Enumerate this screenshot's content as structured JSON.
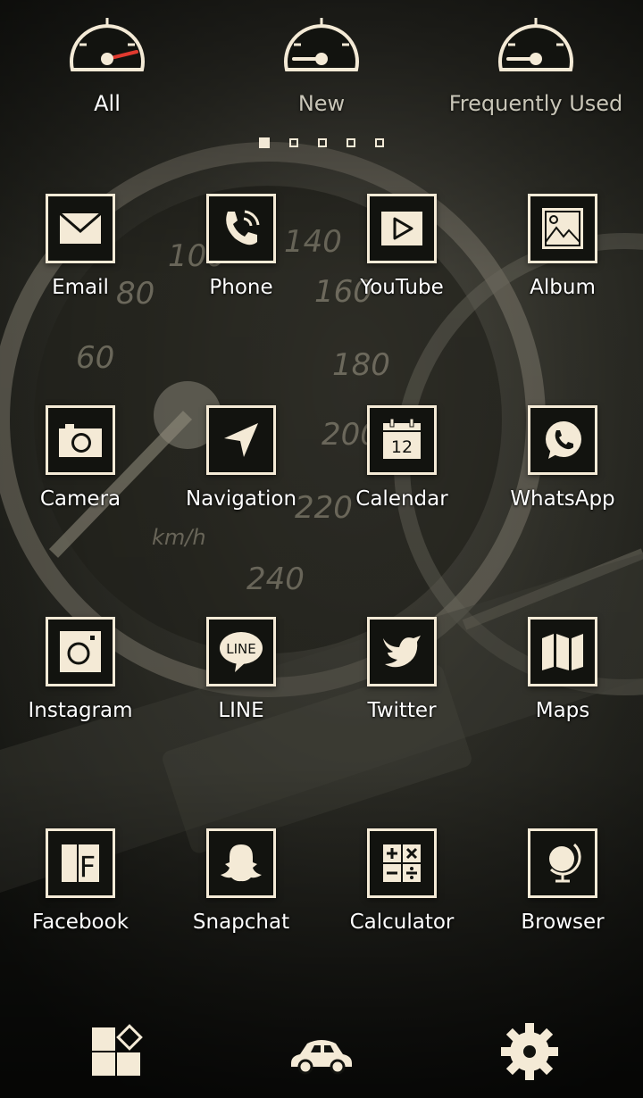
{
  "colors": {
    "accent": "#f4ead6",
    "tile_background": "#12130f",
    "needle": "#e03a2f",
    "label_active": "#ffffff",
    "label_inactive": "#c9c6b8"
  },
  "tabs": [
    {
      "label": "All",
      "icon": "speedometer-icon",
      "active": true
    },
    {
      "label": "New",
      "icon": "speedometer-icon",
      "active": false
    },
    {
      "label": "Frequently Used",
      "icon": "speedometer-icon",
      "active": false
    }
  ],
  "pager": {
    "pages": 5,
    "current": 1
  },
  "apps": [
    {
      "label": "Email",
      "icon": "envelope-icon"
    },
    {
      "label": "Phone",
      "icon": "phone-icon"
    },
    {
      "label": "YouTube",
      "icon": "play-icon"
    },
    {
      "label": "Album",
      "icon": "picture-icon"
    },
    {
      "label": "Camera",
      "icon": "camera-icon"
    },
    {
      "label": "Navigation",
      "icon": "arrow-icon"
    },
    {
      "label": "Calendar",
      "icon": "calendar-icon",
      "icon_text": "12"
    },
    {
      "label": "WhatsApp",
      "icon": "whatsapp-icon"
    },
    {
      "label": "Instagram",
      "icon": "instagram-icon"
    },
    {
      "label": "LINE",
      "icon": "line-bubble-icon",
      "icon_text": "LINE"
    },
    {
      "label": "Twitter",
      "icon": "bird-icon"
    },
    {
      "label": "Maps",
      "icon": "map-icon"
    },
    {
      "label": "Facebook",
      "icon": "facebook-icon",
      "icon_text": "F"
    },
    {
      "label": "Snapchat",
      "icon": "ghost-icon"
    },
    {
      "label": "Calculator",
      "icon": "calculator-icon"
    },
    {
      "label": "Browser",
      "icon": "globe-icon"
    }
  ],
  "dock": [
    {
      "name": "widgets",
      "icon": "widgets-icon"
    },
    {
      "name": "home",
      "icon": "car-icon"
    },
    {
      "name": "settings",
      "icon": "gear-icon"
    }
  ],
  "wallpaper": {
    "speedometer_numbers": [
      "60",
      "80",
      "100",
      "140",
      "160",
      "180",
      "200",
      "220",
      "240"
    ],
    "unit": "km/h"
  }
}
